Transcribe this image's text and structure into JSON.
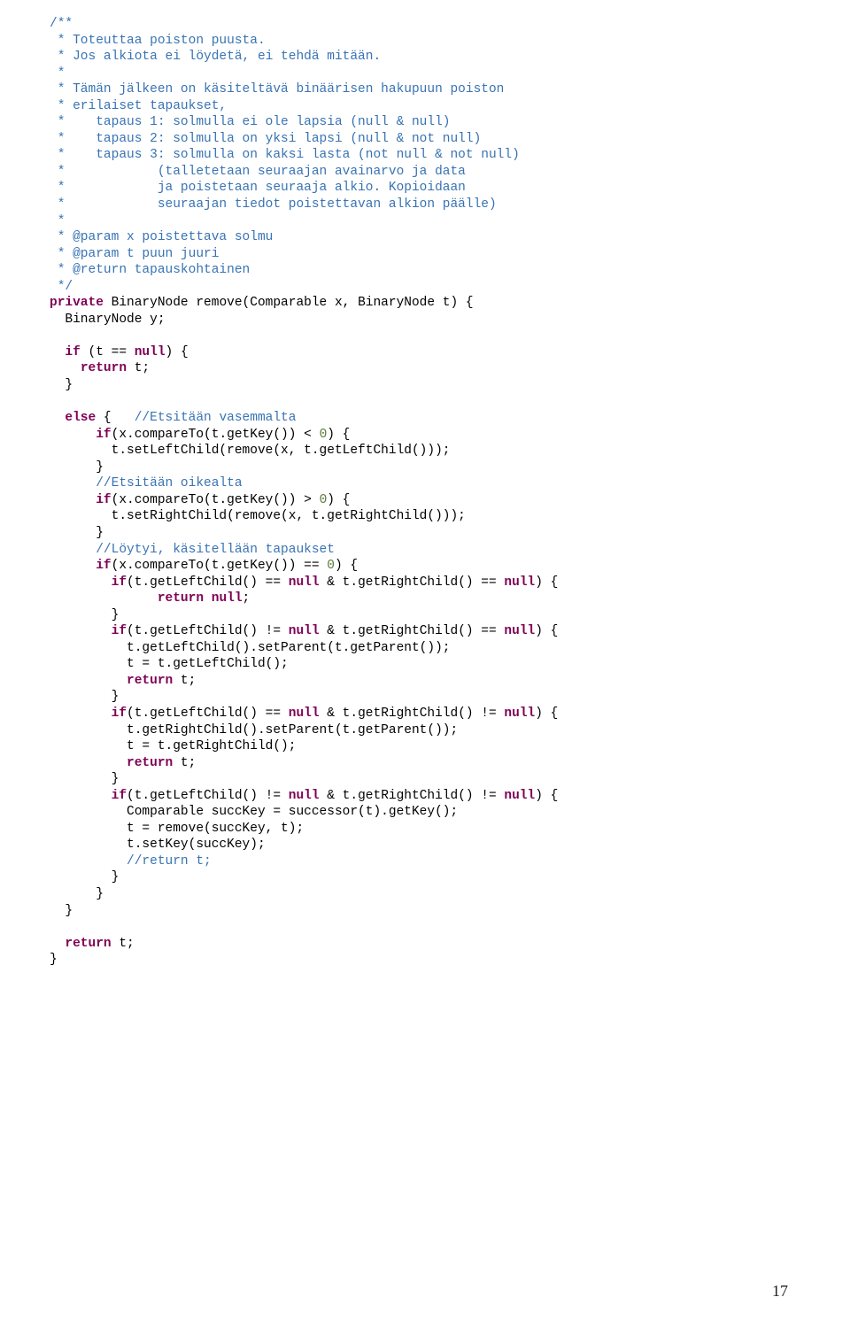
{
  "comment": {
    "l01": "/**",
    "l02": " * Toteuttaa poiston puusta.",
    "l03": " * Jos alkiota ei löydetä, ei tehdä mitään.",
    "l04": " *",
    "l05": " * Tämän jälkeen on käsiteltävä binäärisen hakupuun poiston",
    "l06": " * erilaiset tapaukset,",
    "l07": " *    tapaus 1: solmulla ei ole lapsia (null & null)",
    "l08": " *    tapaus 2: solmulla on yksi lapsi (null & not null)",
    "l09": " *    tapaus 3: solmulla on kaksi lasta (not null & not null)",
    "l10": " *            (talletetaan seuraajan avainarvo ja data",
    "l11": " *            ja poistetaan seuraaja alkio. Kopioidaan",
    "l12": " *            seuraajan tiedot poistettavan alkion päälle)",
    "l13": " *",
    "l14": " * @param x poistettava solmu",
    "l15": " * @param t puun juuri",
    "l16": " * @return tapauskohtainen",
    "l17": " */"
  },
  "kw": {
    "private": "private",
    "if": "if",
    "null": "null",
    "return": "return",
    "else": "else",
    "return_null": "return null"
  },
  "code": {
    "sig1": " BinaryNode remove(Comparable x, BinaryNode t) {",
    "sig2": "  BinaryNode y;",
    "if1_open": " (t == ",
    "if1_close": ") {",
    "return_t": " t;",
    "else_open": " {   ",
    "cmt_left": "//Etsitään vasemmalta",
    "cmp_lt_a": "(x.compareTo(t.getKey()) < ",
    "zero": "0",
    "cmp_lt_b": ") {",
    "set_left": "        t.setLeftChild(remove(x, t.getLeftChild()));",
    "close_b": "      }",
    "cmt_right": "//Etsitään oikealta",
    "cmp_gt_a": "(x.compareTo(t.getKey()) > ",
    "set_right": "        t.setRightChild(remove(x, t.getRightChild()));",
    "cmt_found": "//Löytyi, käsitellään tapaukset",
    "cmp_eq_a": "(x.compareTo(t.getKey()) == ",
    "case1_a": "(t.getLeftChild() == ",
    "case1_b": " & t.getRightChild() == ",
    "case1_c": ") {",
    "semi": ";",
    "close_bb": "        }",
    "case2_a": "(t.getLeftChild() != ",
    "case2_b": " & t.getRightChild() == ",
    "case2_set": "          t.getLeftChild().setParent(t.getParent());",
    "case2_ass": "          t = t.getLeftChild();",
    "case3_a": "(t.getLeftChild() == ",
    "case3_b": " & t.getRightChild() != ",
    "case3_set": "          t.getRightChild().setParent(t.getParent());",
    "case3_ass": "          t = t.getRightChild();",
    "case4_a": "(t.getLeftChild() != ",
    "case4_b": " & t.getRightChild() != ",
    "succ1": "          Comparable succKey = successor(t).getKey();",
    "succ2": "          t = remove(succKey, t);",
    "succ3": "          t.setKey(succKey);",
    "cmt_ret": "//return t;",
    "close_c": "      }",
    "close_d": "  }",
    "close_e": "}"
  },
  "pageNumber": "17"
}
